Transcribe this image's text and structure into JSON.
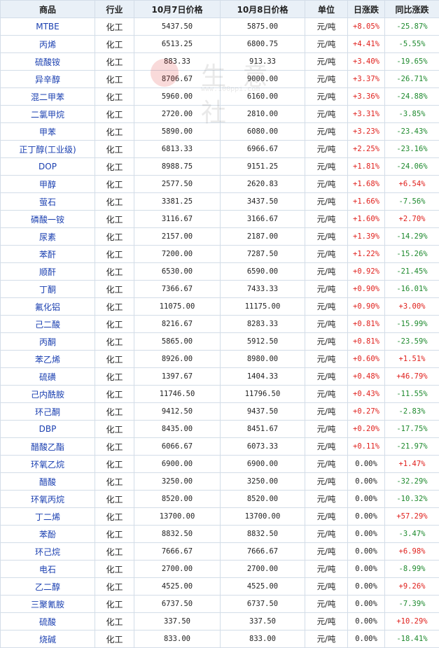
{
  "headers": {
    "product": "商品",
    "industry": "行业",
    "price1": "10月7日价格",
    "price2": "10月8日价格",
    "unit": "单位",
    "daily": "日涨跌",
    "yoy": "同比涨跌"
  },
  "watermark": {
    "text": "生 意 社",
    "sub": "www.100ppi.com"
  },
  "colors": {
    "up": "#e0201c",
    "down": "#1e8a2e",
    "product_link": "#1a3fb0",
    "header_bg": "#e9f0f7"
  },
  "rows": [
    {
      "product": "MTBE",
      "industry": "化工",
      "p1": "5437.50",
      "p2": "5875.00",
      "unit": "元/吨",
      "daily": "+8.05%",
      "yoy": "-25.87%"
    },
    {
      "product": "丙烯",
      "industry": "化工",
      "p1": "6513.25",
      "p2": "6800.75",
      "unit": "元/吨",
      "daily": "+4.41%",
      "yoy": "-5.55%"
    },
    {
      "product": "硫酸铵",
      "industry": "化工",
      "p1": "883.33",
      "p2": "913.33",
      "unit": "元/吨",
      "daily": "+3.40%",
      "yoy": "-19.65%"
    },
    {
      "product": "异辛醇",
      "industry": "化工",
      "p1": "8706.67",
      "p2": "9000.00",
      "unit": "元/吨",
      "daily": "+3.37%",
      "yoy": "-26.71%"
    },
    {
      "product": "混二甲苯",
      "industry": "化工",
      "p1": "5960.00",
      "p2": "6160.00",
      "unit": "元/吨",
      "daily": "+3.36%",
      "yoy": "-24.88%"
    },
    {
      "product": "二氯甲烷",
      "industry": "化工",
      "p1": "2720.00",
      "p2": "2810.00",
      "unit": "元/吨",
      "daily": "+3.31%",
      "yoy": "-3.85%"
    },
    {
      "product": "甲苯",
      "industry": "化工",
      "p1": "5890.00",
      "p2": "6080.00",
      "unit": "元/吨",
      "daily": "+3.23%",
      "yoy": "-23.43%"
    },
    {
      "product": "正丁醇(工业级)",
      "industry": "化工",
      "p1": "6813.33",
      "p2": "6966.67",
      "unit": "元/吨",
      "daily": "+2.25%",
      "yoy": "-23.16%"
    },
    {
      "product": "DOP",
      "industry": "化工",
      "p1": "8988.75",
      "p2": "9151.25",
      "unit": "元/吨",
      "daily": "+1.81%",
      "yoy": "-24.06%"
    },
    {
      "product": "甲醇",
      "industry": "化工",
      "p1": "2577.50",
      "p2": "2620.83",
      "unit": "元/吨",
      "daily": "+1.68%",
      "yoy": "+6.54%"
    },
    {
      "product": "萤石",
      "industry": "化工",
      "p1": "3381.25",
      "p2": "3437.50",
      "unit": "元/吨",
      "daily": "+1.66%",
      "yoy": "-7.56%"
    },
    {
      "product": "磷酸一铵",
      "industry": "化工",
      "p1": "3116.67",
      "p2": "3166.67",
      "unit": "元/吨",
      "daily": "+1.60%",
      "yoy": "+2.70%"
    },
    {
      "product": "尿素",
      "industry": "化工",
      "p1": "2157.00",
      "p2": "2187.00",
      "unit": "元/吨",
      "daily": "+1.39%",
      "yoy": "-14.29%"
    },
    {
      "product": "苯酐",
      "industry": "化工",
      "p1": "7200.00",
      "p2": "7287.50",
      "unit": "元/吨",
      "daily": "+1.22%",
      "yoy": "-15.26%"
    },
    {
      "product": "顺酐",
      "industry": "化工",
      "p1": "6530.00",
      "p2": "6590.00",
      "unit": "元/吨",
      "daily": "+0.92%",
      "yoy": "-21.45%"
    },
    {
      "product": "丁酮",
      "industry": "化工",
      "p1": "7366.67",
      "p2": "7433.33",
      "unit": "元/吨",
      "daily": "+0.90%",
      "yoy": "-16.01%"
    },
    {
      "product": "氟化铝",
      "industry": "化工",
      "p1": "11075.00",
      "p2": "11175.00",
      "unit": "元/吨",
      "daily": "+0.90%",
      "yoy": "+3.00%"
    },
    {
      "product": "己二酸",
      "industry": "化工",
      "p1": "8216.67",
      "p2": "8283.33",
      "unit": "元/吨",
      "daily": "+0.81%",
      "yoy": "-15.99%"
    },
    {
      "product": "丙酮",
      "industry": "化工",
      "p1": "5865.00",
      "p2": "5912.50",
      "unit": "元/吨",
      "daily": "+0.81%",
      "yoy": "-23.59%"
    },
    {
      "product": "苯乙烯",
      "industry": "化工",
      "p1": "8926.00",
      "p2": "8980.00",
      "unit": "元/吨",
      "daily": "+0.60%",
      "yoy": "+1.51%"
    },
    {
      "product": "硫磺",
      "industry": "化工",
      "p1": "1397.67",
      "p2": "1404.33",
      "unit": "元/吨",
      "daily": "+0.48%",
      "yoy": "+46.79%"
    },
    {
      "product": "己内酰胺",
      "industry": "化工",
      "p1": "11746.50",
      "p2": "11796.50",
      "unit": "元/吨",
      "daily": "+0.43%",
      "yoy": "-11.55%"
    },
    {
      "product": "环己酮",
      "industry": "化工",
      "p1": "9412.50",
      "p2": "9437.50",
      "unit": "元/吨",
      "daily": "+0.27%",
      "yoy": "-2.83%"
    },
    {
      "product": "DBP",
      "industry": "化工",
      "p1": "8435.00",
      "p2": "8451.67",
      "unit": "元/吨",
      "daily": "+0.20%",
      "yoy": "-17.75%"
    },
    {
      "product": "醋酸乙酯",
      "industry": "化工",
      "p1": "6066.67",
      "p2": "6073.33",
      "unit": "元/吨",
      "daily": "+0.11%",
      "yoy": "-21.97%"
    },
    {
      "product": "环氧乙烷",
      "industry": "化工",
      "p1": "6900.00",
      "p2": "6900.00",
      "unit": "元/吨",
      "daily": "0.00%",
      "yoy": "+1.47%"
    },
    {
      "product": "醋酸",
      "industry": "化工",
      "p1": "3250.00",
      "p2": "3250.00",
      "unit": "元/吨",
      "daily": "0.00%",
      "yoy": "-32.29%"
    },
    {
      "product": "环氧丙烷",
      "industry": "化工",
      "p1": "8520.00",
      "p2": "8520.00",
      "unit": "元/吨",
      "daily": "0.00%",
      "yoy": "-10.32%"
    },
    {
      "product": "丁二烯",
      "industry": "化工",
      "p1": "13700.00",
      "p2": "13700.00",
      "unit": "元/吨",
      "daily": "0.00%",
      "yoy": "+57.29%"
    },
    {
      "product": "苯酚",
      "industry": "化工",
      "p1": "8832.50",
      "p2": "8832.50",
      "unit": "元/吨",
      "daily": "0.00%",
      "yoy": "-3.47%"
    },
    {
      "product": "环己烷",
      "industry": "化工",
      "p1": "7666.67",
      "p2": "7666.67",
      "unit": "元/吨",
      "daily": "0.00%",
      "yoy": "+6.98%"
    },
    {
      "product": "电石",
      "industry": "化工",
      "p1": "2700.00",
      "p2": "2700.00",
      "unit": "元/吨",
      "daily": "0.00%",
      "yoy": "-8.99%"
    },
    {
      "product": "乙二醇",
      "industry": "化工",
      "p1": "4525.00",
      "p2": "4525.00",
      "unit": "元/吨",
      "daily": "0.00%",
      "yoy": "+9.26%"
    },
    {
      "product": "三聚氰胺",
      "industry": "化工",
      "p1": "6737.50",
      "p2": "6737.50",
      "unit": "元/吨",
      "daily": "0.00%",
      "yoy": "-7.39%"
    },
    {
      "product": "硫酸",
      "industry": "化工",
      "p1": "337.50",
      "p2": "337.50",
      "unit": "元/吨",
      "daily": "0.00%",
      "yoy": "+10.29%"
    },
    {
      "product": "烧碱",
      "industry": "化工",
      "p1": "833.00",
      "p2": "833.00",
      "unit": "元/吨",
      "daily": "0.00%",
      "yoy": "-18.41%"
    }
  ]
}
